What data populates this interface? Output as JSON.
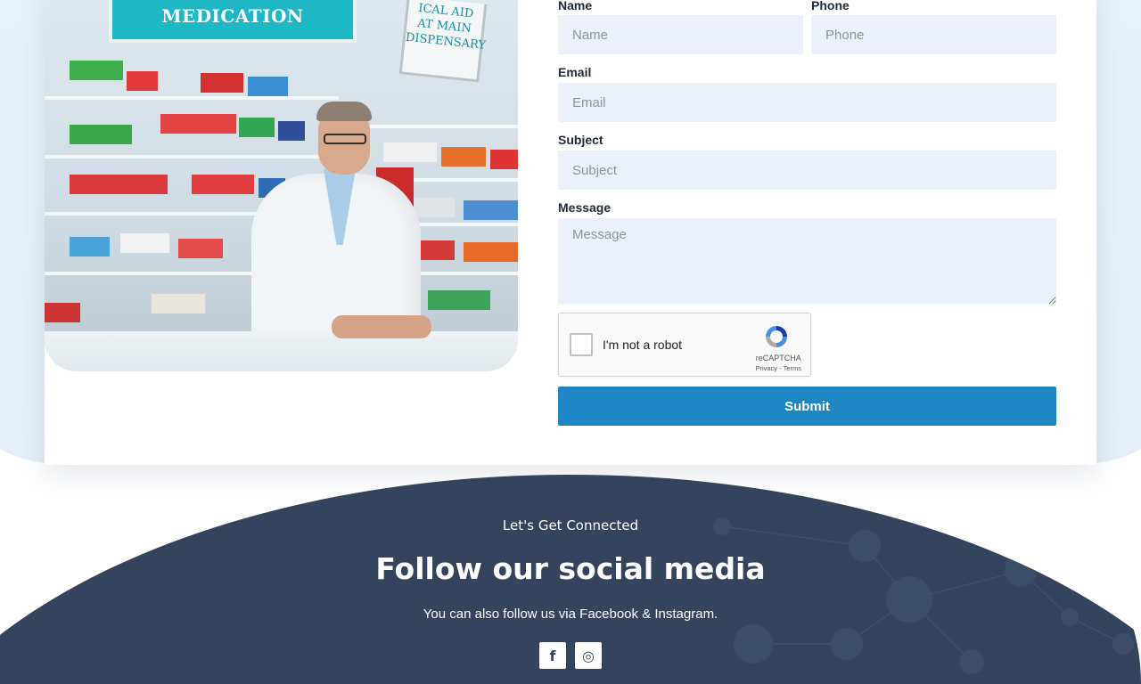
{
  "form": {
    "name": {
      "label": "Name",
      "placeholder": "Name",
      "value": ""
    },
    "phone": {
      "label": "Phone",
      "placeholder": "Phone",
      "value": ""
    },
    "email": {
      "label": "Email",
      "placeholder": "Email",
      "value": ""
    },
    "subject": {
      "label": "Subject",
      "placeholder": "Subject",
      "value": ""
    },
    "message": {
      "label": "Message",
      "placeholder": "Message",
      "value": ""
    },
    "submit_label": "Submit"
  },
  "recaptcha": {
    "checkbox_label": "I'm not a robot",
    "brand": "reCAPTCHA",
    "links": "Privacy - Terms",
    "checked": false
  },
  "photo": {
    "sign_main": "MEDICATION",
    "sign_aid_lines": [
      "ICAL AID",
      "AT MAIN",
      "DISPENSARY"
    ]
  },
  "footer": {
    "subtitle": "Let's Get Connected",
    "title": "Follow our social media",
    "description": "You can also follow us via Facebook & Instagram.",
    "social": [
      {
        "name": "facebook",
        "icon": "facebook-icon",
        "glyph": "f"
      },
      {
        "name": "instagram",
        "icon": "instagram-icon",
        "glyph": "◎"
      }
    ]
  },
  "colors": {
    "accent": "#1f85c4",
    "field_bg": "#ecf0fb",
    "footer_bg": "#34445c",
    "backdrop": "#e3eef8"
  }
}
